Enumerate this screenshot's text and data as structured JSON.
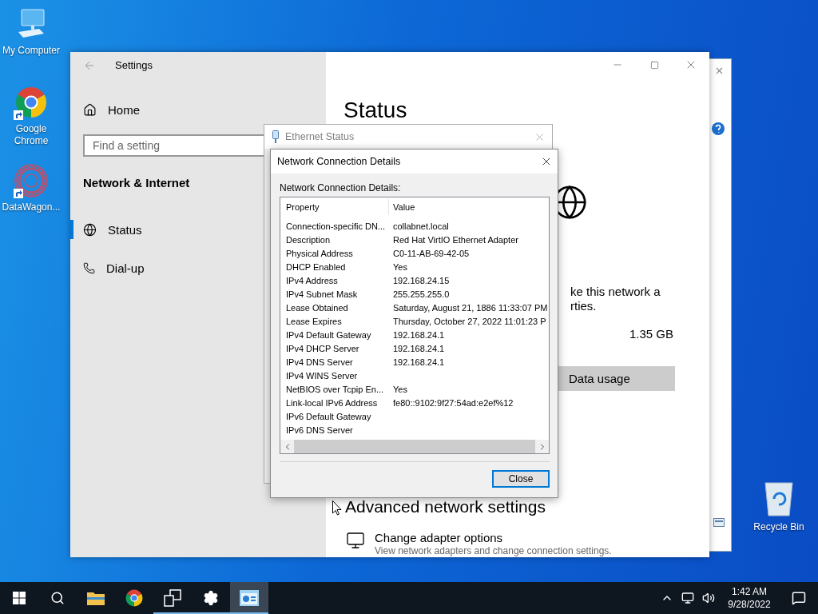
{
  "desktop_icons": [
    {
      "label": "My Computer",
      "kind": "computer",
      "shortcut": false
    },
    {
      "label": "Google Chrome",
      "kind": "chrome",
      "shortcut": true
    },
    {
      "label": "DataWagon...",
      "kind": "datawagon",
      "shortcut": true
    }
  ],
  "recycle_bin": {
    "label": "Recycle Bin"
  },
  "settings_window": {
    "title": "Settings",
    "home": "Home",
    "search": {
      "placeholder": "Find a setting"
    },
    "section": "Network & Internet",
    "nav": [
      {
        "label": "Status",
        "kind": "globe",
        "selected": true
      },
      {
        "label": "Dial-up",
        "kind": "phone",
        "selected": false
      }
    ],
    "heading": "Status",
    "partial_lines": [
      "ke this network a",
      "rties."
    ],
    "data_amount": "1.35 GB",
    "data_usage_button": "Data usage",
    "advanced_heading": "Advanced network settings",
    "adapter": {
      "title": "Change adapter options",
      "description": "View network adapters and change connection settings."
    }
  },
  "ethernet_status": {
    "title": "Ethernet Status"
  },
  "details_dialog": {
    "title": "Network Connection Details",
    "label": "Network Connection Details:",
    "columns": [
      "Property",
      "Value"
    ],
    "rows": [
      {
        "property": "Connection-specific DN...",
        "value": "collabnet.local"
      },
      {
        "property": "Description",
        "value": "Red Hat VirtIO Ethernet Adapter"
      },
      {
        "property": "Physical Address",
        "value": "C0-11-AB-69-42-05"
      },
      {
        "property": "DHCP Enabled",
        "value": "Yes"
      },
      {
        "property": "IPv4 Address",
        "value": "192.168.24.15"
      },
      {
        "property": "IPv4 Subnet Mask",
        "value": "255.255.255.0"
      },
      {
        "property": "Lease Obtained",
        "value": "Saturday, August 21, 1886 11:33:07 PM"
      },
      {
        "property": "Lease Expires",
        "value": "Thursday, October 27, 2022 11:01:23 P"
      },
      {
        "property": "IPv4 Default Gateway",
        "value": "192.168.24.1"
      },
      {
        "property": "IPv4 DHCP Server",
        "value": "192.168.24.1"
      },
      {
        "property": "IPv4 DNS Server",
        "value": "192.168.24.1"
      },
      {
        "property": "IPv4 WINS Server"
      },
      {
        "property": "NetBIOS over Tcpip En...",
        "value": "Yes"
      },
      {
        "property": "Link-local IPv6 Address",
        "value": "fe80::9102:9f27:54ad:e2ef%12"
      },
      {
        "property": "IPv6 Default Gateway"
      },
      {
        "property": "IPv6 DNS Server"
      }
    ],
    "close_button": "Close"
  },
  "taskbar": {
    "apps": [
      {
        "kind": "start",
        "running": false,
        "active": false
      },
      {
        "kind": "search",
        "running": false,
        "active": false
      },
      {
        "kind": "explorer",
        "running": false,
        "active": false
      },
      {
        "kind": "chrome",
        "running": false,
        "active": false
      },
      {
        "kind": "taskview",
        "running": true,
        "active": false
      },
      {
        "kind": "settings",
        "running": true,
        "active": false
      },
      {
        "kind": "controlpanel",
        "running": true,
        "active": true
      }
    ],
    "time": "1:42 AM",
    "date": "9/28/2022"
  }
}
